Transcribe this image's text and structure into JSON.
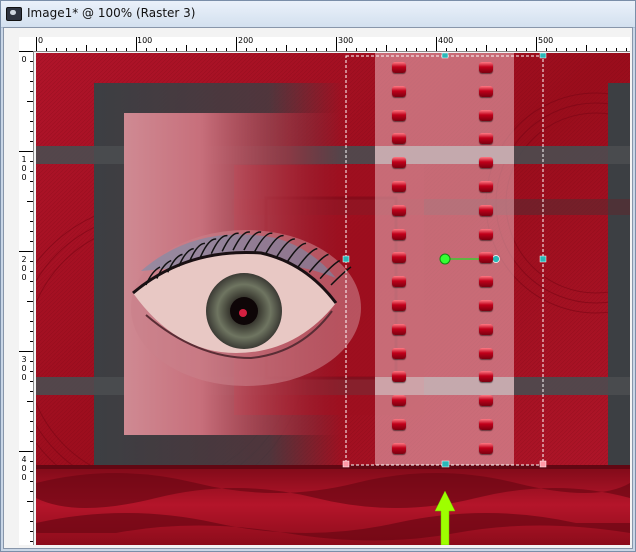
{
  "window": {
    "title": "Image1* @ 100% (Raster 3)",
    "app_icon": "camera-icon"
  },
  "ruler_top": {
    "labels": [
      "0",
      "100",
      "200",
      "300",
      "400",
      "500"
    ]
  },
  "ruler_left": {
    "labels": [
      "0",
      "100",
      "200",
      "300",
      "400"
    ]
  },
  "colors": {
    "canvas_red": "#a4101f",
    "dark_gray": "#3c3f43",
    "arrow_green": "#9eff00",
    "handle_teal": "#2ab8b8"
  }
}
